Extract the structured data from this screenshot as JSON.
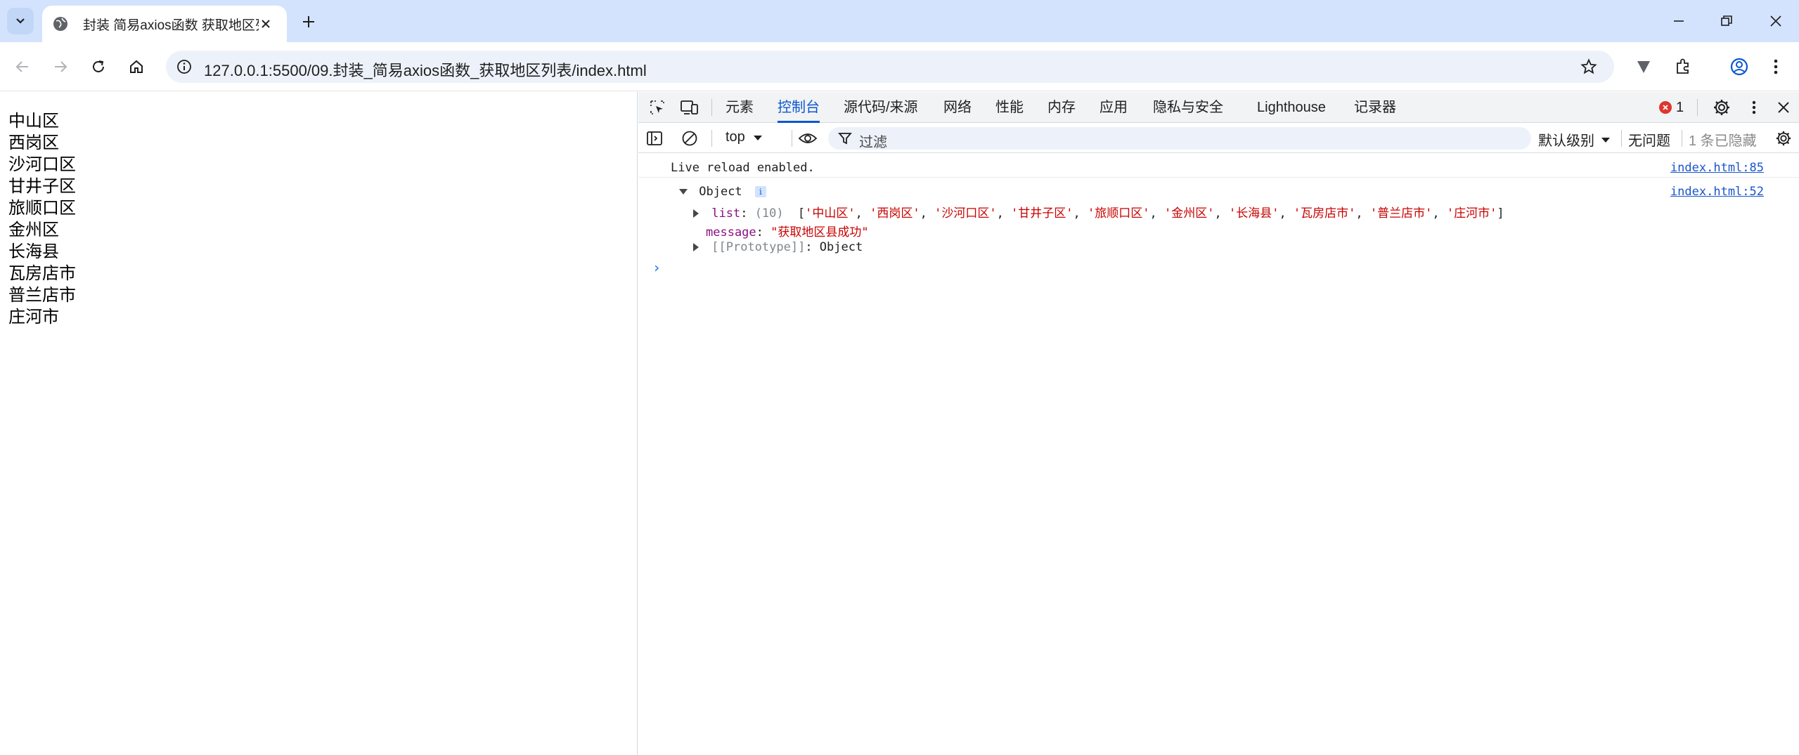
{
  "browser": {
    "tab_title": "封装 简易axios函数 获取地区列表",
    "url": "127.0.0.1:5500/09.封装_简易axios函数_获取地区列表/index.html"
  },
  "page": {
    "regions": [
      "中山区",
      "西岗区",
      "沙河口区",
      "甘井子区",
      "旅顺口区",
      "金州区",
      "长海县",
      "瓦房店市",
      "普兰店市",
      "庄河市"
    ]
  },
  "devtools": {
    "tabs": [
      "元素",
      "控制台",
      "源代码/来源",
      "网络",
      "性能",
      "内存",
      "应用",
      "隐私与安全",
      "Lighthouse",
      "记录器"
    ],
    "active_tab": "控制台",
    "error_count": "1",
    "context": "top",
    "filter_placeholder": "过滤",
    "levels_label": "默认级别",
    "issues_label": "无问题",
    "hidden_label": "1 条已隐藏",
    "console": {
      "live_reload_text": "Live reload enabled.",
      "live_reload_source": "index.html:85",
      "object_label": "Object",
      "object_source": "index.html:52",
      "list_key": "list",
      "list_count": "(10)",
      "list_values": [
        "'中山区'",
        "'西岗区'",
        "'沙河口区'",
        "'甘井子区'",
        "'旅顺口区'",
        "'金州区'",
        "'长海县'",
        "'瓦房店市'",
        "'普兰店市'",
        "'庄河市'"
      ],
      "message_key": "message",
      "message_value": "\"获取地区县成功\"",
      "prototype_key": "[[Prototype]]",
      "prototype_value": "Object"
    }
  },
  "colors": {
    "tabstrip": "#d3e3fd",
    "accent": "#0b57d0",
    "error": "#dc362e",
    "string": "#c80000",
    "key": "#881280"
  }
}
